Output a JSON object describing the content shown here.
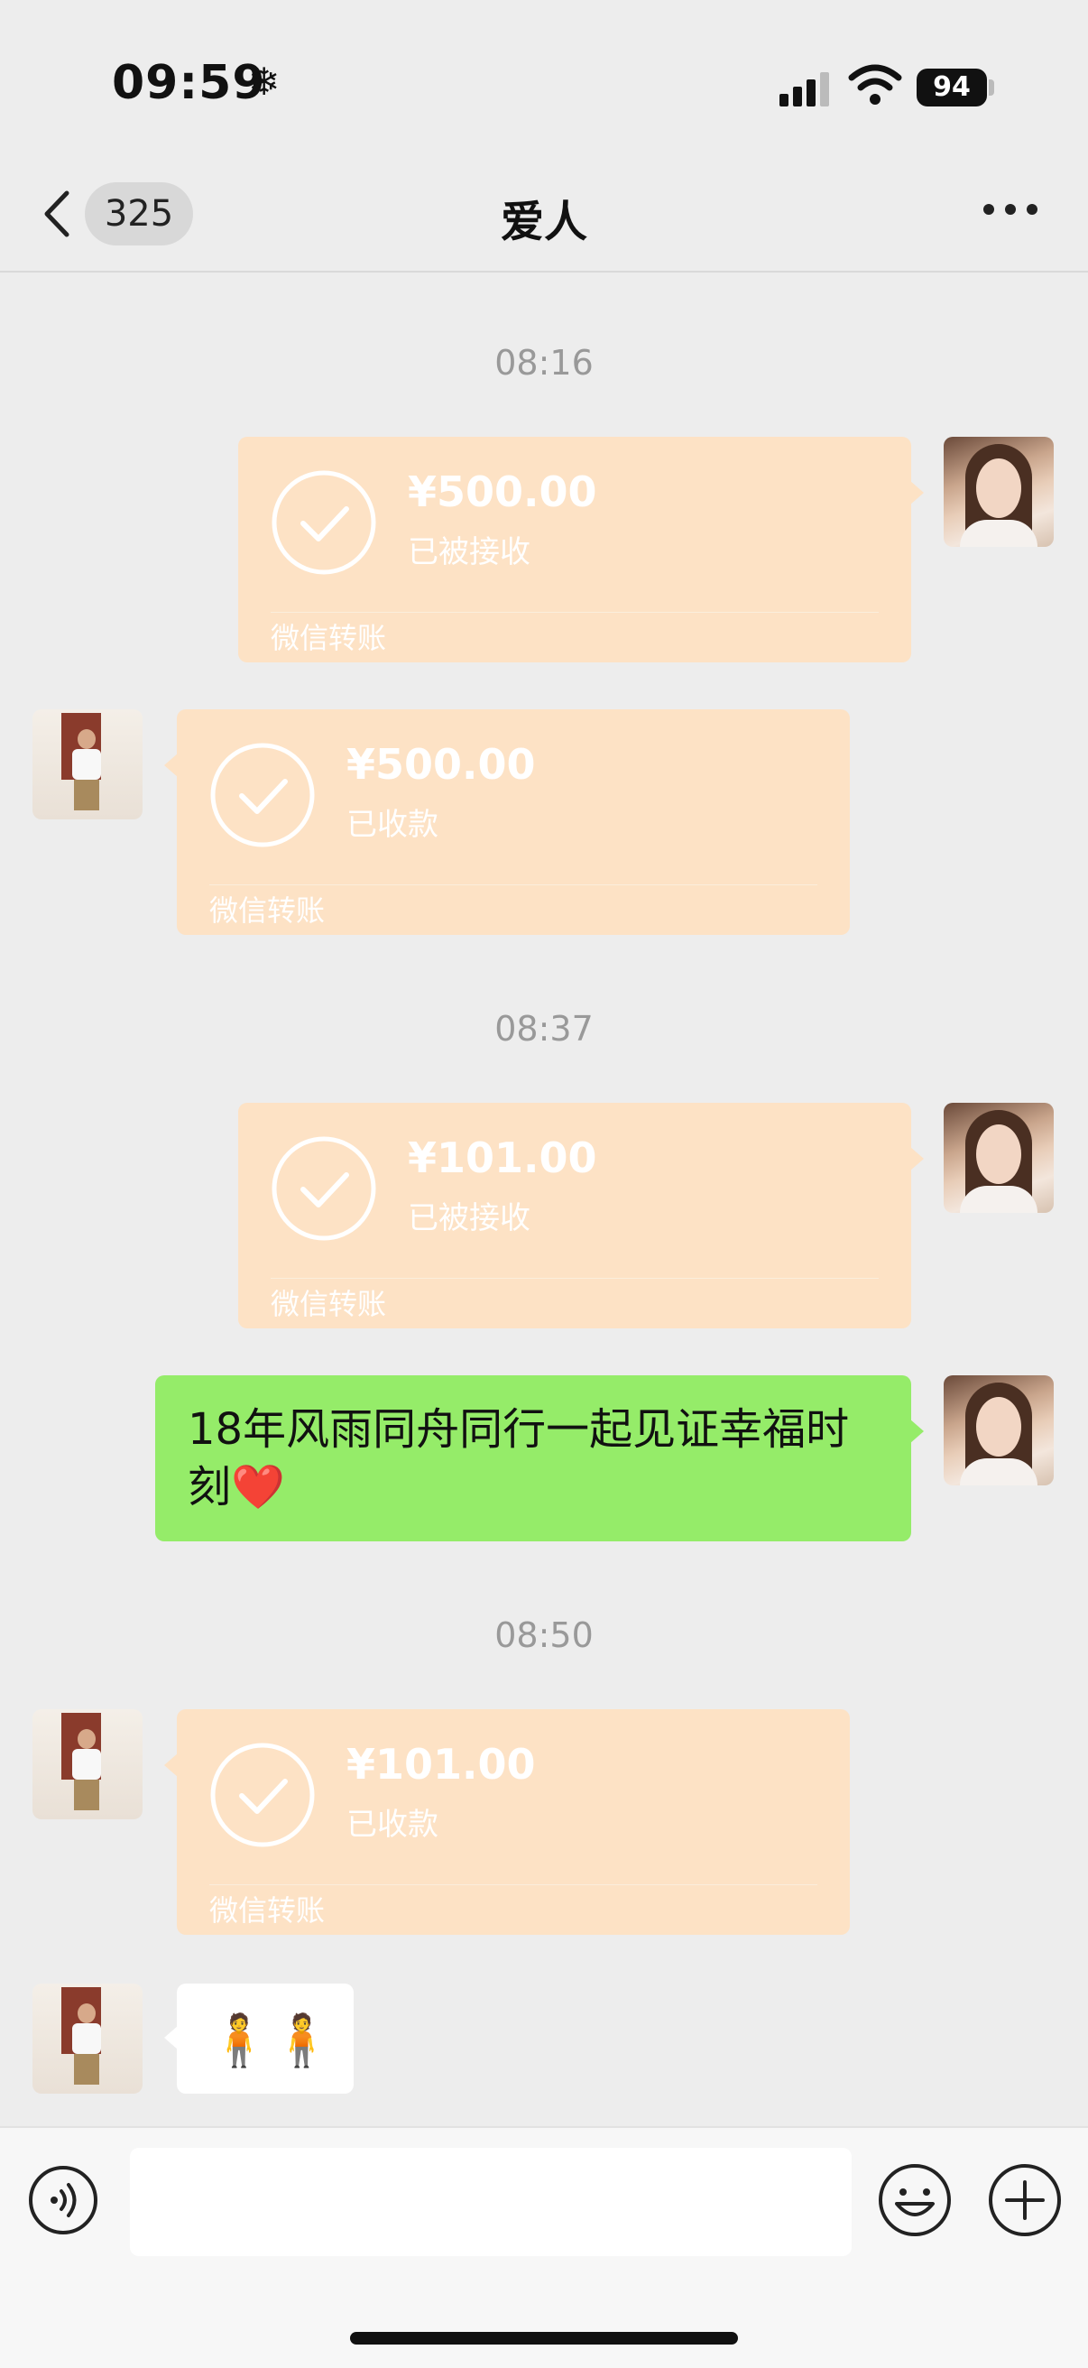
{
  "status_bar": {
    "time": "09:59",
    "weather_glyph": "❄",
    "battery": "94"
  },
  "nav": {
    "unread_count": "325",
    "title": "爱人"
  },
  "messages": {
    "time_1": "08:16",
    "card_1": {
      "amount": "¥500.00",
      "status": "已被接收",
      "footer": "微信转账"
    },
    "card_2": {
      "amount": "¥500.00",
      "status": "已收款",
      "footer": "微信转账"
    },
    "time_2": "08:37",
    "card_3": {
      "amount": "¥101.00",
      "status": "已被接收",
      "footer": "微信转账"
    },
    "text_1": "18年风雨同舟同行一起见证幸福时刻❤️",
    "time_3": "08:50",
    "card_4": {
      "amount": "¥101.00",
      "status": "已收款",
      "footer": "微信转账"
    },
    "emoji_1": "🧍🧍"
  },
  "colors": {
    "transfer_card": "#fde2c5",
    "sent_bubble": "#95ec69",
    "background": "#ededed"
  },
  "icons": [
    "back-chevron-icon",
    "more-icon",
    "check-circle-icon",
    "voice-icon",
    "emoji-icon",
    "plus-icon",
    "signal-icon",
    "wifi-icon"
  ]
}
